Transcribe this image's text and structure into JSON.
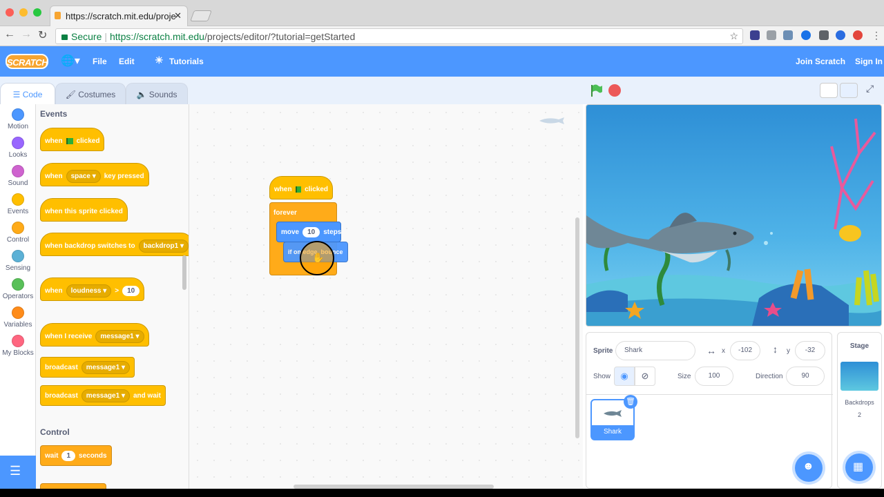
{
  "browser": {
    "tab_title": "https://scratch.mit.edu/proje",
    "tab_close": "✕",
    "secure_label": "Secure",
    "url_host": "https://scratch.mit.edu",
    "url_path": "/projects/editor/?tutorial=getStarted"
  },
  "menu": {
    "logo": "SCRATCH",
    "file": "File",
    "edit": "Edit",
    "tutorials": "Tutorials",
    "join": "Join Scratch",
    "signin": "Sign In"
  },
  "editor_tabs": {
    "code": "Code",
    "costumes": "Costumes",
    "sounds": "Sounds"
  },
  "categories": [
    {
      "label": "Motion",
      "color": "#4c97ff"
    },
    {
      "label": "Looks",
      "color": "#9966ff"
    },
    {
      "label": "Sound",
      "color": "#cf63cf"
    },
    {
      "label": "Events",
      "color": "#ffbf00"
    },
    {
      "label": "Control",
      "color": "#ffab19"
    },
    {
      "label": "Sensing",
      "color": "#5cb1d6"
    },
    {
      "label": "Operators",
      "color": "#59c059"
    },
    {
      "label": "Variables",
      "color": "#ff8c1a"
    },
    {
      "label": "My Blocks",
      "color": "#ff6680"
    }
  ],
  "palette": {
    "events_heading": "Events",
    "control_heading": "Control",
    "when": "when",
    "clicked": "clicked",
    "space": "space",
    "key_pressed": "key pressed",
    "when_sprite_clicked": "when this sprite clicked",
    "when_backdrop_switches": "when backdrop switches to",
    "backdrop1": "backdrop1",
    "loudness": "loudness",
    "gt": ">",
    "loud_val": "10",
    "when_i_receive": "when I receive",
    "message1": "message1",
    "broadcast": "broadcast",
    "and_wait": "and wait",
    "wait": "wait",
    "wait_val": "1",
    "seconds": "seconds"
  },
  "script": {
    "when": "when",
    "clicked": "clicked",
    "forever": "forever",
    "move": "move",
    "move_val": "10",
    "steps": "steps",
    "bounce": "if on edge, bounce"
  },
  "zoom": {
    "in": "+",
    "out": "−",
    "reset": "="
  },
  "sprite_info": {
    "sprite_label": "Sprite",
    "sprite_name": "Shark",
    "x_label": "x",
    "x_val": "-102",
    "y_label": "y",
    "y_val": "-32",
    "show_label": "Show",
    "size_label": "Size",
    "size_val": "100",
    "direction_label": "Direction",
    "direction_val": "90"
  },
  "sprite_thumb": {
    "name": "Shark"
  },
  "stage_col": {
    "title": "Stage",
    "backdrops_label": "Backdrops",
    "backdrops_count": "2"
  }
}
